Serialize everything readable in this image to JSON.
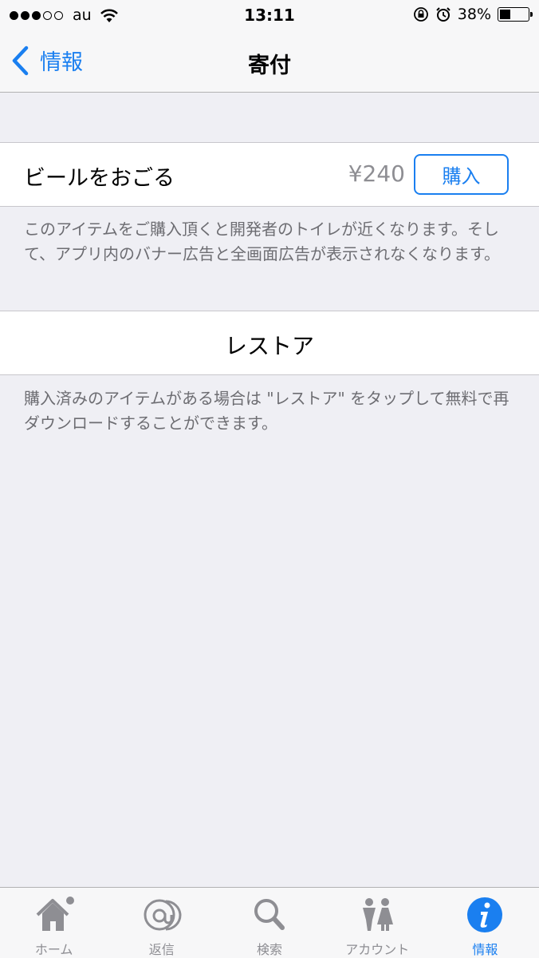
{
  "status_bar": {
    "carrier": "au",
    "time": "13:11",
    "battery_percent": "38%",
    "battery_level": 0.38
  },
  "nav": {
    "back_label": "情報",
    "title": "寄付"
  },
  "donation": {
    "item_label": "ビールをおごる",
    "price": "¥240",
    "buy_label": "購入",
    "footer": "このアイテムをご購入頂くと開発者のトイレが近くなります。そして、アプリ内のバナー広告と全画面広告が表示されなくなります。"
  },
  "restore": {
    "label": "レストア",
    "footer": "購入済みのアイテムがある場合は \"レストア\" をタップして無料で再ダウンロードすることができます。"
  },
  "tabs": [
    {
      "label": "ホーム",
      "icon": "home-icon"
    },
    {
      "label": "返信",
      "icon": "at-icon"
    },
    {
      "label": "検索",
      "icon": "search-icon"
    },
    {
      "label": "アカウント",
      "icon": "people-icon"
    },
    {
      "label": "情報",
      "icon": "info-icon",
      "active": true
    }
  ],
  "colors": {
    "accent": "#1a7ff0",
    "background": "#efeff4",
    "secondary_text": "#6d6d72",
    "tab_inactive": "#8e8e93"
  }
}
